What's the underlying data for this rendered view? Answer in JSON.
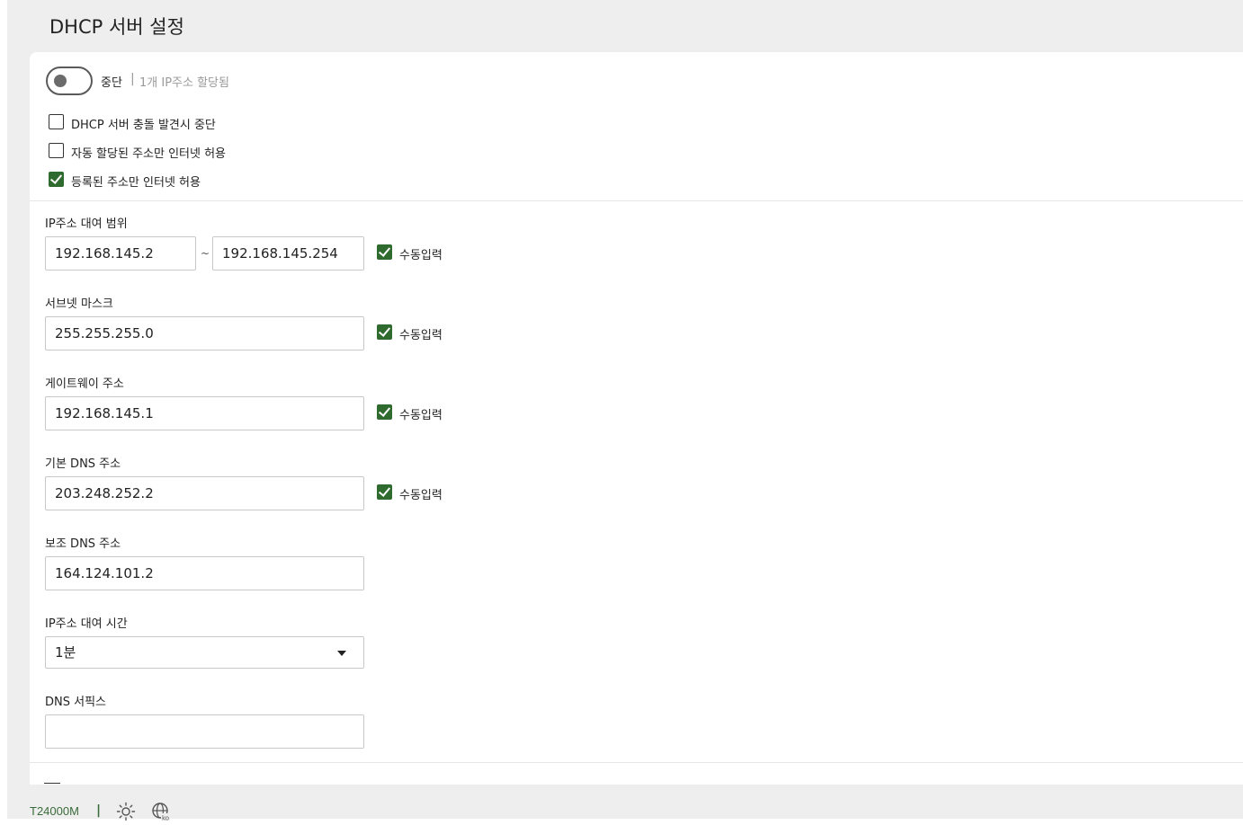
{
  "page": {
    "title": "DHCP 서버 설정"
  },
  "server_toggle": {
    "state": "중단",
    "separator": "|",
    "info": "1개 IP주소 할당됨"
  },
  "options": [
    {
      "label": "DHCP 서버 충돌 발견시 중단",
      "checked": false
    },
    {
      "label": "자동 할당된 주소만 인터넷 허용",
      "checked": false
    },
    {
      "label": "등록된 주소만 인터넷 허용",
      "checked": true
    }
  ],
  "fields": {
    "ip_range": {
      "label": "IP주소 대여 범위",
      "start": "192.168.145.2",
      "separator": "~",
      "end": "192.168.145.254",
      "manual_label": "수동입력",
      "manual": true
    },
    "subnet_mask": {
      "label": "서브넷 마스크",
      "value": "255.255.255.0",
      "manual_label": "수동입력",
      "manual": true
    },
    "gateway": {
      "label": "게이트웨이 주소",
      "value": "192.168.145.1",
      "manual_label": "수동입력",
      "manual": true
    },
    "primary_dns": {
      "label": "기본 DNS 주소",
      "value": "203.248.252.2",
      "manual_label": "수동입력",
      "manual": true
    },
    "secondary_dns": {
      "label": "보조 DNS 주소",
      "value": "164.124.101.2"
    },
    "lease_time": {
      "label": "IP주소 대여 시간",
      "selected": "1분"
    },
    "dns_suffix": {
      "label": "DNS 서픽스",
      "value": ""
    }
  },
  "footer": {
    "model": "T24000M",
    "separator": "|",
    "icons": [
      "brightness-icon",
      "language-icon"
    ]
  },
  "colors": {
    "accent": "#2f6b2f",
    "background": "#eeeeee",
    "panel": "#ffffff"
  }
}
